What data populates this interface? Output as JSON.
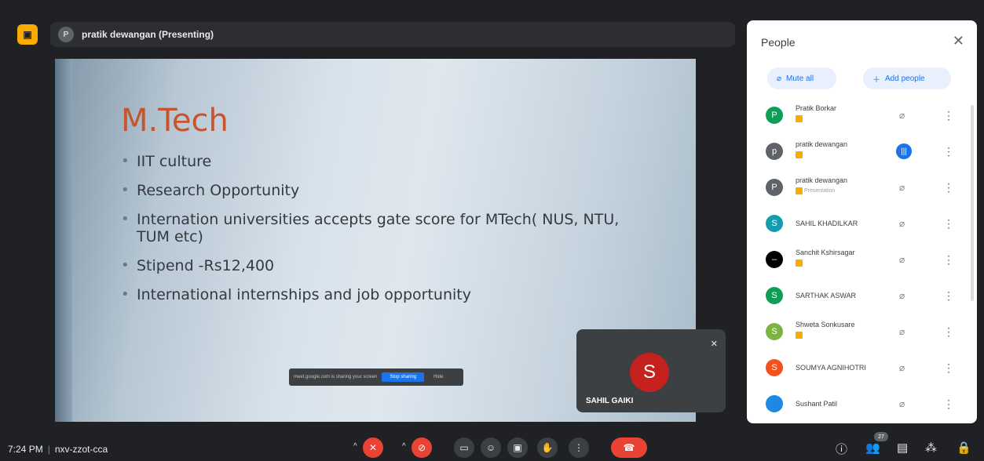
{
  "header": {
    "presenter_initial": "P",
    "presenter_label": "pratik dewangan (Presenting)"
  },
  "slide": {
    "title": "M.Tech",
    "bullets": [
      "IIT culture",
      "Research Opportunity",
      "Internation universities accepts gate score for MTech( NUS, NTU, TUM etc)",
      "Stipend -Rs12,400",
      "International internships and job opportunity"
    ],
    "share_notice": {
      "text": "meet.google.com is sharing your screen",
      "stop_label": "Stop sharing",
      "hide_label": "Hide"
    }
  },
  "self_tile": {
    "initial": "S",
    "name": "SAHIL GAIKI"
  },
  "people_panel": {
    "title": "People",
    "mute_all_label": "Mute all",
    "add_people_label": "Add people",
    "people": [
      {
        "initial": "P",
        "name": "Pratik Borkar",
        "tag": "",
        "color": "#0f9d58",
        "mic": "muted"
      },
      {
        "initial": "p",
        "name": "pratik dewangan",
        "tag": "",
        "color": "#5f6368",
        "mic": "speaking"
      },
      {
        "initial": "P",
        "name": "pratik dewangan",
        "tag": "Presentation",
        "color": "#5f6368",
        "mic": "muted"
      },
      {
        "initial": "S",
        "name": "SAHIL KHADILKAR",
        "tag": "",
        "color": "#129eaf",
        "mic": "muted"
      },
      {
        "initial": "–",
        "name": "Sanchit Kshirsagar",
        "tag": "",
        "color": "#000000",
        "mic": "muted"
      },
      {
        "initial": "S",
        "name": "SARTHAK ASWAR",
        "tag": "",
        "color": "#0f9d58",
        "mic": "muted"
      },
      {
        "initial": "S",
        "name": "Shweta Sonkusare",
        "tag": "",
        "color": "#7cb342",
        "mic": "muted"
      },
      {
        "initial": "S",
        "name": "SOUMYA AGNIHOTRI",
        "tag": "",
        "color": "#f4511e",
        "mic": "muted"
      },
      {
        "initial": "",
        "name": "Sushant Patil",
        "tag": "",
        "color": "#1e88e5",
        "mic": "muted"
      }
    ]
  },
  "bottom_bar": {
    "time": "7:24 PM",
    "meeting_code": "nxv-zzot-cca",
    "participant_count": "27"
  },
  "colors": {
    "accent_red": "#ea4335",
    "accent_blue": "#1a73e8",
    "presenter_badge": "#f9ab00"
  }
}
